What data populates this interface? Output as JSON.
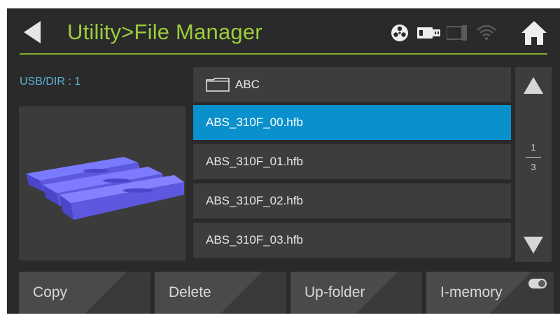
{
  "header": {
    "title": "Utility>File Manager"
  },
  "status_icons": [
    "filament-reel-icon",
    "usb-icon",
    "lan-icon",
    "wifi-icon"
  ],
  "left_panel": {
    "usb_label": "USB/DIR : 1"
  },
  "file_list": {
    "items": [
      {
        "label": "ABC",
        "type": "folder",
        "selected": false
      },
      {
        "label": "ABS_310F_00.hfb",
        "type": "file",
        "selected": true
      },
      {
        "label": "ABS_310F_01.hfb",
        "type": "file",
        "selected": false
      },
      {
        "label": "ABS_310F_02.hfb",
        "type": "file",
        "selected": false
      },
      {
        "label": "ABS_310F_03.hfb",
        "type": "file",
        "selected": false
      }
    ]
  },
  "pagination": {
    "current": "1",
    "total": "3"
  },
  "buttons": {
    "copy": "Copy",
    "delete": "Delete",
    "up_folder": "Up-folder",
    "i_memory": "I-memory"
  },
  "colors": {
    "title": "#9ccc3c",
    "selected_row": "#0a90cc",
    "usb_label": "#5fb0d6",
    "background": "#2a2a2a"
  }
}
